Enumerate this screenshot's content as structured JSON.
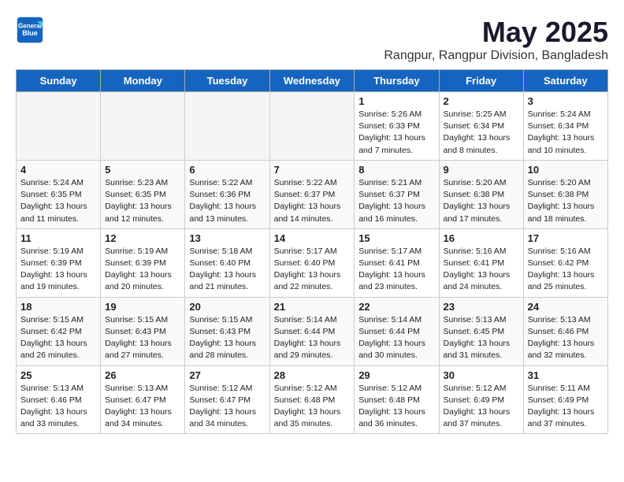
{
  "logo": {
    "line1": "General",
    "line2": "Blue"
  },
  "title": "May 2025",
  "subtitle": "Rangpur, Rangpur Division, Bangladesh",
  "weekdays": [
    "Sunday",
    "Monday",
    "Tuesday",
    "Wednesday",
    "Thursday",
    "Friday",
    "Saturday"
  ],
  "weeks": [
    [
      {
        "day": "",
        "info": ""
      },
      {
        "day": "",
        "info": ""
      },
      {
        "day": "",
        "info": ""
      },
      {
        "day": "",
        "info": ""
      },
      {
        "day": "1",
        "info": "Sunrise: 5:26 AM\nSunset: 6:33 PM\nDaylight: 13 hours\nand 7 minutes."
      },
      {
        "day": "2",
        "info": "Sunrise: 5:25 AM\nSunset: 6:34 PM\nDaylight: 13 hours\nand 8 minutes."
      },
      {
        "day": "3",
        "info": "Sunrise: 5:24 AM\nSunset: 6:34 PM\nDaylight: 13 hours\nand 10 minutes."
      }
    ],
    [
      {
        "day": "4",
        "info": "Sunrise: 5:24 AM\nSunset: 6:35 PM\nDaylight: 13 hours\nand 11 minutes."
      },
      {
        "day": "5",
        "info": "Sunrise: 5:23 AM\nSunset: 6:35 PM\nDaylight: 13 hours\nand 12 minutes."
      },
      {
        "day": "6",
        "info": "Sunrise: 5:22 AM\nSunset: 6:36 PM\nDaylight: 13 hours\nand 13 minutes."
      },
      {
        "day": "7",
        "info": "Sunrise: 5:22 AM\nSunset: 6:37 PM\nDaylight: 13 hours\nand 14 minutes."
      },
      {
        "day": "8",
        "info": "Sunrise: 5:21 AM\nSunset: 6:37 PM\nDaylight: 13 hours\nand 16 minutes."
      },
      {
        "day": "9",
        "info": "Sunrise: 5:20 AM\nSunset: 6:38 PM\nDaylight: 13 hours\nand 17 minutes."
      },
      {
        "day": "10",
        "info": "Sunrise: 5:20 AM\nSunset: 6:38 PM\nDaylight: 13 hours\nand 18 minutes."
      }
    ],
    [
      {
        "day": "11",
        "info": "Sunrise: 5:19 AM\nSunset: 6:39 PM\nDaylight: 13 hours\nand 19 minutes."
      },
      {
        "day": "12",
        "info": "Sunrise: 5:19 AM\nSunset: 6:39 PM\nDaylight: 13 hours\nand 20 minutes."
      },
      {
        "day": "13",
        "info": "Sunrise: 5:18 AM\nSunset: 6:40 PM\nDaylight: 13 hours\nand 21 minutes."
      },
      {
        "day": "14",
        "info": "Sunrise: 5:17 AM\nSunset: 6:40 PM\nDaylight: 13 hours\nand 22 minutes."
      },
      {
        "day": "15",
        "info": "Sunrise: 5:17 AM\nSunset: 6:41 PM\nDaylight: 13 hours\nand 23 minutes."
      },
      {
        "day": "16",
        "info": "Sunrise: 5:16 AM\nSunset: 6:41 PM\nDaylight: 13 hours\nand 24 minutes."
      },
      {
        "day": "17",
        "info": "Sunrise: 5:16 AM\nSunset: 6:42 PM\nDaylight: 13 hours\nand 25 minutes."
      }
    ],
    [
      {
        "day": "18",
        "info": "Sunrise: 5:15 AM\nSunset: 6:42 PM\nDaylight: 13 hours\nand 26 minutes."
      },
      {
        "day": "19",
        "info": "Sunrise: 5:15 AM\nSunset: 6:43 PM\nDaylight: 13 hours\nand 27 minutes."
      },
      {
        "day": "20",
        "info": "Sunrise: 5:15 AM\nSunset: 6:43 PM\nDaylight: 13 hours\nand 28 minutes."
      },
      {
        "day": "21",
        "info": "Sunrise: 5:14 AM\nSunset: 6:44 PM\nDaylight: 13 hours\nand 29 minutes."
      },
      {
        "day": "22",
        "info": "Sunrise: 5:14 AM\nSunset: 6:44 PM\nDaylight: 13 hours\nand 30 minutes."
      },
      {
        "day": "23",
        "info": "Sunrise: 5:13 AM\nSunset: 6:45 PM\nDaylight: 13 hours\nand 31 minutes."
      },
      {
        "day": "24",
        "info": "Sunrise: 5:13 AM\nSunset: 6:46 PM\nDaylight: 13 hours\nand 32 minutes."
      }
    ],
    [
      {
        "day": "25",
        "info": "Sunrise: 5:13 AM\nSunset: 6:46 PM\nDaylight: 13 hours\nand 33 minutes."
      },
      {
        "day": "26",
        "info": "Sunrise: 5:13 AM\nSunset: 6:47 PM\nDaylight: 13 hours\nand 34 minutes."
      },
      {
        "day": "27",
        "info": "Sunrise: 5:12 AM\nSunset: 6:47 PM\nDaylight: 13 hours\nand 34 minutes."
      },
      {
        "day": "28",
        "info": "Sunrise: 5:12 AM\nSunset: 6:48 PM\nDaylight: 13 hours\nand 35 minutes."
      },
      {
        "day": "29",
        "info": "Sunrise: 5:12 AM\nSunset: 6:48 PM\nDaylight: 13 hours\nand 36 minutes."
      },
      {
        "day": "30",
        "info": "Sunrise: 5:12 AM\nSunset: 6:49 PM\nDaylight: 13 hours\nand 37 minutes."
      },
      {
        "day": "31",
        "info": "Sunrise: 5:11 AM\nSunset: 6:49 PM\nDaylight: 13 hours\nand 37 minutes."
      }
    ]
  ]
}
